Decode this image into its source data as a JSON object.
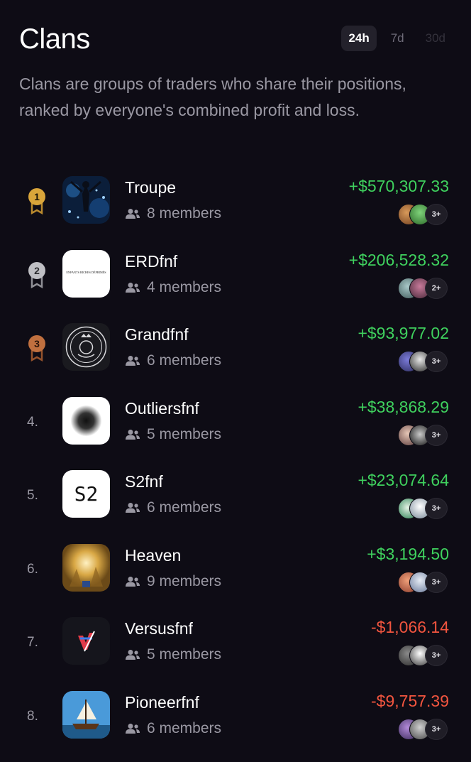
{
  "header": {
    "title": "Clans",
    "tabs": [
      {
        "label": "24h",
        "state": "active"
      },
      {
        "label": "7d",
        "state": "inactive"
      },
      {
        "label": "30d",
        "state": "disabled"
      }
    ]
  },
  "description": "Clans are groups of traders who share their positions, ranked by everyone's combined profit and loss.",
  "colors": {
    "background": "#0e0c15",
    "positive": "#3fd15e",
    "negative": "#f2553f",
    "gold": "#d9a53a",
    "silver": "#bfbfc4",
    "bronze": "#c0703f"
  },
  "clans": [
    {
      "rank": "1",
      "name": "Troupe",
      "members": "8 members",
      "pnl": "+$570,307.33",
      "sign": "pos",
      "more": "3+",
      "icon": "troupe-logo-icon"
    },
    {
      "rank": "2",
      "name": "ERDfnf",
      "members": "4 members",
      "pnl": "+$206,528.32",
      "sign": "pos",
      "more": "2+",
      "icon": "erdfnf-logo-icon",
      "icon_text": "ENFANTS RICHES DÉPRIMÉS"
    },
    {
      "rank": "3",
      "name": "Grandfnf",
      "members": "6 members",
      "pnl": "+$93,977.02",
      "sign": "pos",
      "more": "3+",
      "icon": "grandfnf-logo-icon"
    },
    {
      "rank": "4.",
      "name": "Outliersfnf",
      "members": "5 members",
      "pnl": "+$38,868.29",
      "sign": "pos",
      "more": "3+",
      "icon": "outliersfnf-logo-icon"
    },
    {
      "rank": "5.",
      "name": "S2fnf",
      "members": "6 members",
      "pnl": "+$23,074.64",
      "sign": "pos",
      "more": "3+",
      "icon": "s2fnf-logo-icon",
      "icon_text": "S2"
    },
    {
      "rank": "6.",
      "name": "Heaven",
      "members": "9 members",
      "pnl": "+$3,194.50",
      "sign": "pos",
      "more": "3+",
      "icon": "heaven-logo-icon"
    },
    {
      "rank": "7.",
      "name": "Versusfnf",
      "members": "5 members",
      "pnl": "-$1,066.14",
      "sign": "neg",
      "more": "3+",
      "icon": "versusfnf-logo-icon"
    },
    {
      "rank": "8.",
      "name": "Pioneerfnf",
      "members": "6 members",
      "pnl": "-$9,757.39",
      "sign": "neg",
      "more": "3+",
      "icon": "pioneerfnf-logo-icon"
    }
  ]
}
